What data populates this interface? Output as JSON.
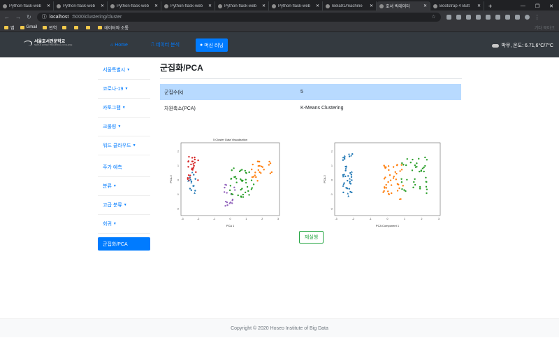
{
  "browser": {
    "tabs": [
      {
        "title": "Python-flask-web",
        "active": false
      },
      {
        "title": "Python-flask-web",
        "active": false
      },
      {
        "title": "Python-flask-web",
        "active": false
      },
      {
        "title": "Python-flask-web",
        "active": false
      },
      {
        "title": "Python-flask-web",
        "active": false
      },
      {
        "title": "Python-flask-web",
        "active": false
      },
      {
        "title": "leela91/machine",
        "active": false
      },
      {
        "title": "호서 빅데이터",
        "active": true
      },
      {
        "title": "Bootstrap 4 Butt",
        "active": false
      }
    ],
    "url_host": "localhost",
    "url_path": ":5000/clustering/cluster",
    "bookmarks": [
      {
        "label": "앱",
        "dim": false
      },
      {
        "label": "Gmail",
        "dim": false
      },
      {
        "label": "번역",
        "dim": false
      },
      {
        "label": "",
        "dim": true
      },
      {
        "label": "",
        "dim": true
      },
      {
        "label": "",
        "dim": true
      },
      {
        "label": "데이터와 소통",
        "dim": false
      }
    ],
    "bookmarks_right": "기타 북마크"
  },
  "navbar": {
    "logo_title": "서울호서전문학교",
    "logo_sub": "SEOUL HOSEO TECHNICAL COLLEGE",
    "home": "Home",
    "data_analysis": "데이터 분석",
    "machine_learning": "머신 러닝",
    "weather": "박무, 온도: 6.71,6°C/7°C"
  },
  "sidebar": {
    "items": [
      {
        "label": "서울특별시",
        "caret": true
      },
      {
        "label": "코로나-19",
        "caret": true
      },
      {
        "label": "카토그램",
        "caret": true
      },
      {
        "label": "크롤링",
        "caret": true
      },
      {
        "label": "워드 클라우드",
        "caret": true
      },
      {
        "label": "주가 예측",
        "caret": false
      },
      {
        "label": "분류",
        "caret": true
      },
      {
        "label": "고급 분류",
        "caret": true
      },
      {
        "label": "회귀",
        "caret": true
      },
      {
        "label": "군집화/PCA",
        "caret": false
      }
    ]
  },
  "main": {
    "title": "군집화/PCA",
    "table": [
      {
        "key": "군집수(k)",
        "value": "5"
      },
      {
        "key": "차원축소(PCA)",
        "value": "K-Means Clustering"
      }
    ],
    "rerun_button": "재실행"
  },
  "plot_left": {
    "title": "5 Cluster Data Visualization",
    "xlabel": "PCA 1",
    "ylabel": "PCA 2",
    "xticks": [
      "-3",
      "-2",
      "-1",
      "0",
      "1",
      "2",
      "3"
    ],
    "yticks": [
      "2",
      "1",
      "0",
      "-1",
      "-2"
    ]
  },
  "plot_right": {
    "title": "",
    "xlabel": "PCA Component 1",
    "ylabel": "PCA 2",
    "xticks": [
      "-3",
      "-2",
      "-1",
      "0",
      "1",
      "2",
      "3"
    ],
    "yticks": [
      "2",
      "1",
      "0",
      "-1",
      "-2"
    ]
  },
  "colors": {
    "blue": "#1f77b4",
    "orange": "#ff7f0e",
    "green": "#2ca02c",
    "red": "#d62728",
    "purple": "#9467bd",
    "primary": "#007bff",
    "success": "#28a745"
  },
  "footer": "Copyright © 2020 Hoseo Institute of Big Data"
}
